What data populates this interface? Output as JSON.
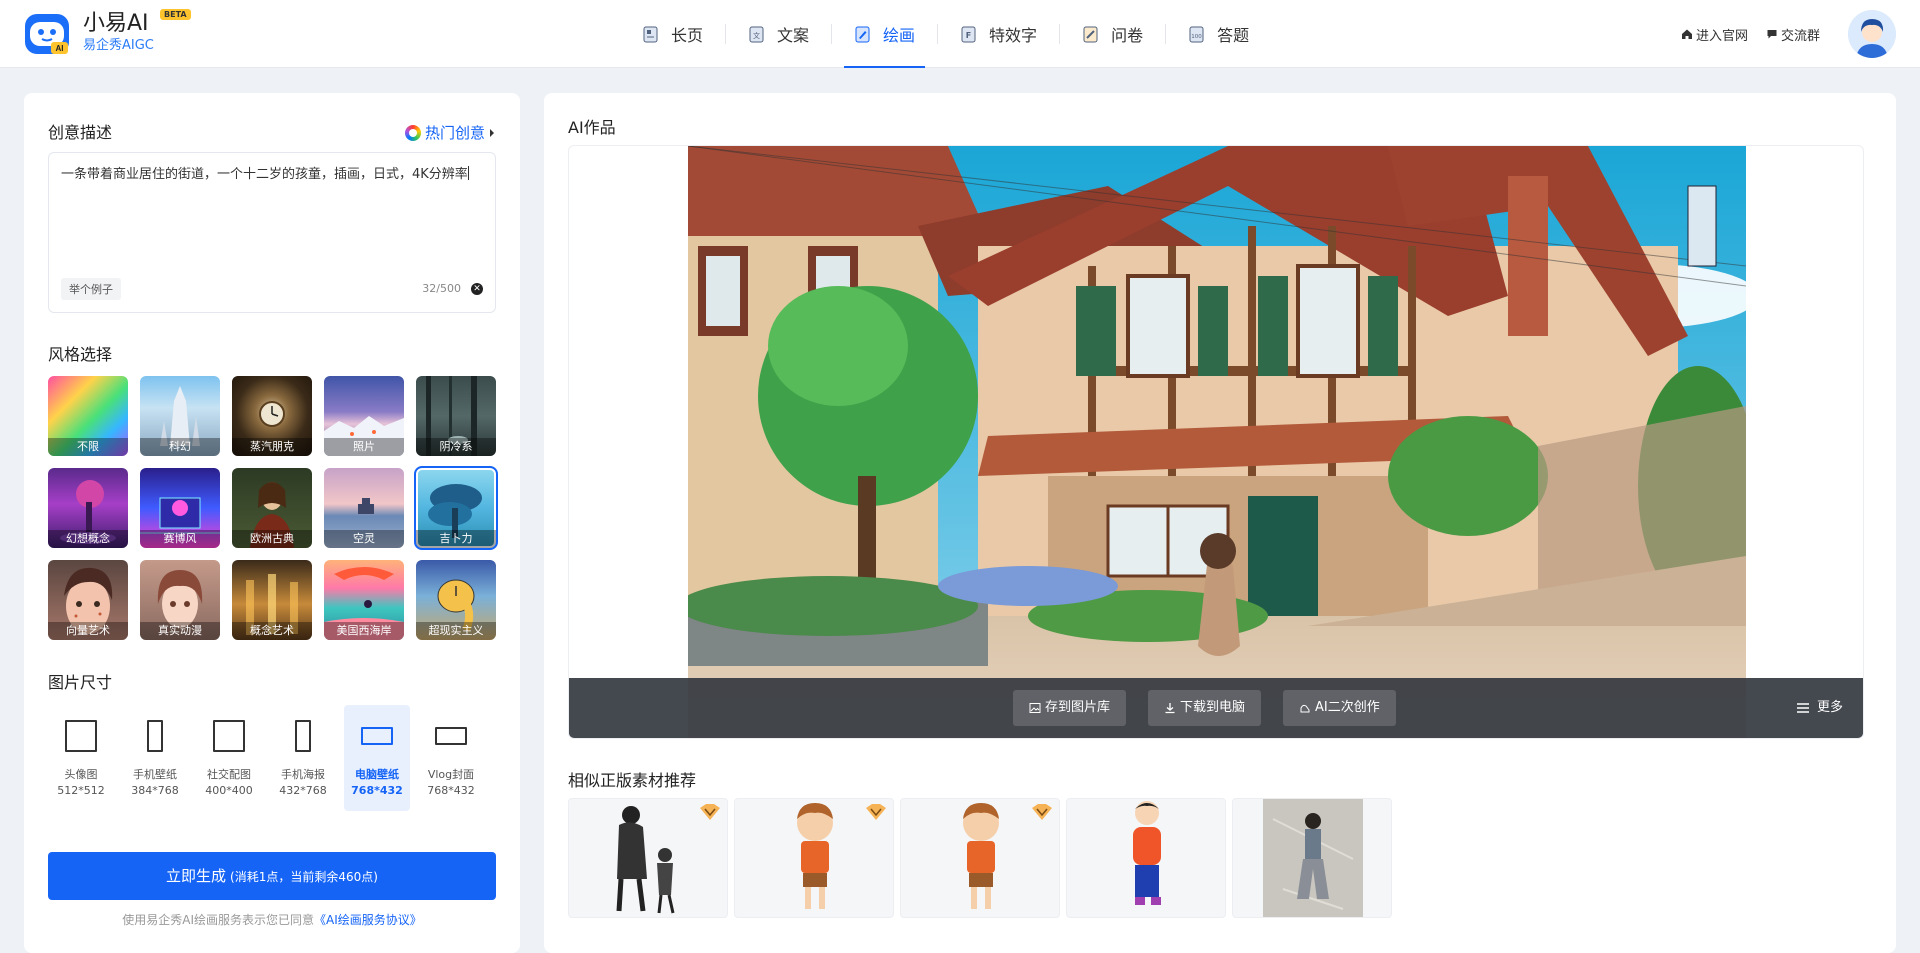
{
  "brand": {
    "name": "小易AI",
    "beta": "BETA",
    "subtitle": "易企秀AIGC",
    "logo_badge": "AI"
  },
  "nav": [
    {
      "label": "长页",
      "icon": "long-page-icon"
    },
    {
      "label": "文案",
      "icon": "copywriting-icon"
    },
    {
      "label": "绘画",
      "icon": "painting-icon",
      "active": true
    },
    {
      "label": "特效字",
      "icon": "effect-text-icon"
    },
    {
      "label": "问卷",
      "icon": "survey-icon"
    },
    {
      "label": "答题",
      "icon": "quiz-icon"
    }
  ],
  "header_links": {
    "website": "进入官网",
    "group": "交流群"
  },
  "left": {
    "prompt_title": "创意描述",
    "hot_label": "热门创意",
    "prompt_value": "一条带着商业居住的街道，一个十二岁的孩童，插画，日式，4K分辨率",
    "example_label": "举个例子",
    "counter": "32/500",
    "style_title": "风格选择",
    "styles": [
      "不限",
      "科幻",
      "蒸汽朋克",
      "照片",
      "阴冷系",
      "幻想概念",
      "赛博风",
      "欧洲古典",
      "空灵",
      "吉卜力",
      "向量艺术",
      "真实动漫",
      "概念艺术",
      "美国西海岸",
      "超现实主义"
    ],
    "selected_style": "吉卜力",
    "size_title": "图片尺寸",
    "sizes": [
      {
        "name": "头像图",
        "dim": "512*512"
      },
      {
        "name": "手机壁纸",
        "dim": "384*768"
      },
      {
        "name": "社交配图",
        "dim": "400*400"
      },
      {
        "name": "手机海报",
        "dim": "432*768"
      },
      {
        "name": "电脑壁纸",
        "dim": "768*432"
      },
      {
        "name": "Vlog封面",
        "dim": "768*432"
      }
    ],
    "selected_size": "电脑壁纸",
    "generate_label": "立即生成",
    "generate_note": "(消耗1点，当前剩余460点)",
    "agree_text": "使用易企秀AI绘画服务表示您已同意",
    "agree_link": "《AI绘画服务协议》"
  },
  "right": {
    "works_title": "AI作品",
    "actions": {
      "save": "存到图片库",
      "download": "下载到电脑",
      "remix": "AI二次创作",
      "more": "更多"
    },
    "recommend_title": "相似正版素材推荐"
  },
  "colors": {
    "accent": "#1564f6",
    "panel_bg": "#eef1f6",
    "vip_badge": "#f5b356"
  }
}
